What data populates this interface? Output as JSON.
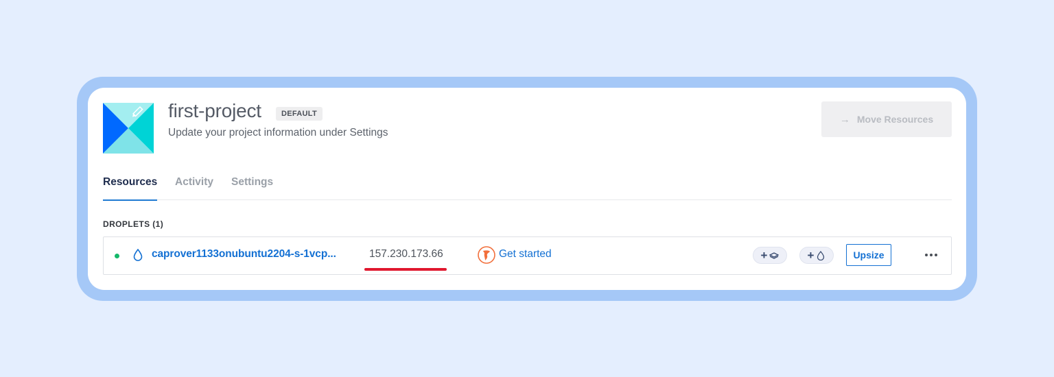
{
  "project": {
    "title": "first-project",
    "badge": "DEFAULT",
    "subtitle": "Update your project information under Settings",
    "move_resources_label": "Move Resources"
  },
  "tabs": [
    {
      "label": "Resources",
      "active": true
    },
    {
      "label": "Activity",
      "active": false
    },
    {
      "label": "Settings",
      "active": false
    }
  ],
  "droplets": {
    "section_label": "DROPLETS (1)",
    "items": [
      {
        "name": "caprover1133onubuntu2204-s-1vcp...",
        "ip": "157.230.173.66",
        "status": "active",
        "app_link": "Get started",
        "upsize_label": "Upsize",
        "add_volume_icon": "volume-icon",
        "add_backup_icon": "droplet-icon"
      }
    ]
  },
  "colors": {
    "background": "#e4eefe",
    "frame": "#a5c8f7",
    "link": "#1370d3",
    "status_active": "#15b86a",
    "highlight_underline": "#e0182f"
  }
}
